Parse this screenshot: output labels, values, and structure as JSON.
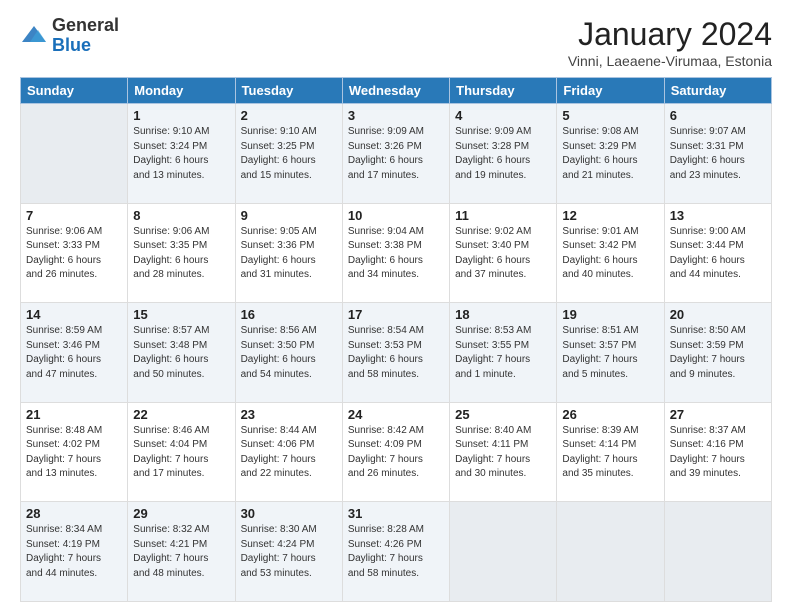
{
  "header": {
    "logo_general": "General",
    "logo_blue": "Blue",
    "month_title": "January 2024",
    "subtitle": "Vinni, Laeaene-Virumaa, Estonia"
  },
  "weekdays": [
    "Sunday",
    "Monday",
    "Tuesday",
    "Wednesday",
    "Thursday",
    "Friday",
    "Saturday"
  ],
  "weeks": [
    [
      {
        "day": "",
        "info": ""
      },
      {
        "day": "1",
        "info": "Sunrise: 9:10 AM\nSunset: 3:24 PM\nDaylight: 6 hours\nand 13 minutes."
      },
      {
        "day": "2",
        "info": "Sunrise: 9:10 AM\nSunset: 3:25 PM\nDaylight: 6 hours\nand 15 minutes."
      },
      {
        "day": "3",
        "info": "Sunrise: 9:09 AM\nSunset: 3:26 PM\nDaylight: 6 hours\nand 17 minutes."
      },
      {
        "day": "4",
        "info": "Sunrise: 9:09 AM\nSunset: 3:28 PM\nDaylight: 6 hours\nand 19 minutes."
      },
      {
        "day": "5",
        "info": "Sunrise: 9:08 AM\nSunset: 3:29 PM\nDaylight: 6 hours\nand 21 minutes."
      },
      {
        "day": "6",
        "info": "Sunrise: 9:07 AM\nSunset: 3:31 PM\nDaylight: 6 hours\nand 23 minutes."
      }
    ],
    [
      {
        "day": "7",
        "info": "Sunrise: 9:06 AM\nSunset: 3:33 PM\nDaylight: 6 hours\nand 26 minutes."
      },
      {
        "day": "8",
        "info": "Sunrise: 9:06 AM\nSunset: 3:35 PM\nDaylight: 6 hours\nand 28 minutes."
      },
      {
        "day": "9",
        "info": "Sunrise: 9:05 AM\nSunset: 3:36 PM\nDaylight: 6 hours\nand 31 minutes."
      },
      {
        "day": "10",
        "info": "Sunrise: 9:04 AM\nSunset: 3:38 PM\nDaylight: 6 hours\nand 34 minutes."
      },
      {
        "day": "11",
        "info": "Sunrise: 9:02 AM\nSunset: 3:40 PM\nDaylight: 6 hours\nand 37 minutes."
      },
      {
        "day": "12",
        "info": "Sunrise: 9:01 AM\nSunset: 3:42 PM\nDaylight: 6 hours\nand 40 minutes."
      },
      {
        "day": "13",
        "info": "Sunrise: 9:00 AM\nSunset: 3:44 PM\nDaylight: 6 hours\nand 44 minutes."
      }
    ],
    [
      {
        "day": "14",
        "info": "Sunrise: 8:59 AM\nSunset: 3:46 PM\nDaylight: 6 hours\nand 47 minutes."
      },
      {
        "day": "15",
        "info": "Sunrise: 8:57 AM\nSunset: 3:48 PM\nDaylight: 6 hours\nand 50 minutes."
      },
      {
        "day": "16",
        "info": "Sunrise: 8:56 AM\nSunset: 3:50 PM\nDaylight: 6 hours\nand 54 minutes."
      },
      {
        "day": "17",
        "info": "Sunrise: 8:54 AM\nSunset: 3:53 PM\nDaylight: 6 hours\nand 58 minutes."
      },
      {
        "day": "18",
        "info": "Sunrise: 8:53 AM\nSunset: 3:55 PM\nDaylight: 7 hours\nand 1 minute."
      },
      {
        "day": "19",
        "info": "Sunrise: 8:51 AM\nSunset: 3:57 PM\nDaylight: 7 hours\nand 5 minutes."
      },
      {
        "day": "20",
        "info": "Sunrise: 8:50 AM\nSunset: 3:59 PM\nDaylight: 7 hours\nand 9 minutes."
      }
    ],
    [
      {
        "day": "21",
        "info": "Sunrise: 8:48 AM\nSunset: 4:02 PM\nDaylight: 7 hours\nand 13 minutes."
      },
      {
        "day": "22",
        "info": "Sunrise: 8:46 AM\nSunset: 4:04 PM\nDaylight: 7 hours\nand 17 minutes."
      },
      {
        "day": "23",
        "info": "Sunrise: 8:44 AM\nSunset: 4:06 PM\nDaylight: 7 hours\nand 22 minutes."
      },
      {
        "day": "24",
        "info": "Sunrise: 8:42 AM\nSunset: 4:09 PM\nDaylight: 7 hours\nand 26 minutes."
      },
      {
        "day": "25",
        "info": "Sunrise: 8:40 AM\nSunset: 4:11 PM\nDaylight: 7 hours\nand 30 minutes."
      },
      {
        "day": "26",
        "info": "Sunrise: 8:39 AM\nSunset: 4:14 PM\nDaylight: 7 hours\nand 35 minutes."
      },
      {
        "day": "27",
        "info": "Sunrise: 8:37 AM\nSunset: 4:16 PM\nDaylight: 7 hours\nand 39 minutes."
      }
    ],
    [
      {
        "day": "28",
        "info": "Sunrise: 8:34 AM\nSunset: 4:19 PM\nDaylight: 7 hours\nand 44 minutes."
      },
      {
        "day": "29",
        "info": "Sunrise: 8:32 AM\nSunset: 4:21 PM\nDaylight: 7 hours\nand 48 minutes."
      },
      {
        "day": "30",
        "info": "Sunrise: 8:30 AM\nSunset: 4:24 PM\nDaylight: 7 hours\nand 53 minutes."
      },
      {
        "day": "31",
        "info": "Sunrise: 8:28 AM\nSunset: 4:26 PM\nDaylight: 7 hours\nand 58 minutes."
      },
      {
        "day": "",
        "info": ""
      },
      {
        "day": "",
        "info": ""
      },
      {
        "day": "",
        "info": ""
      }
    ]
  ]
}
